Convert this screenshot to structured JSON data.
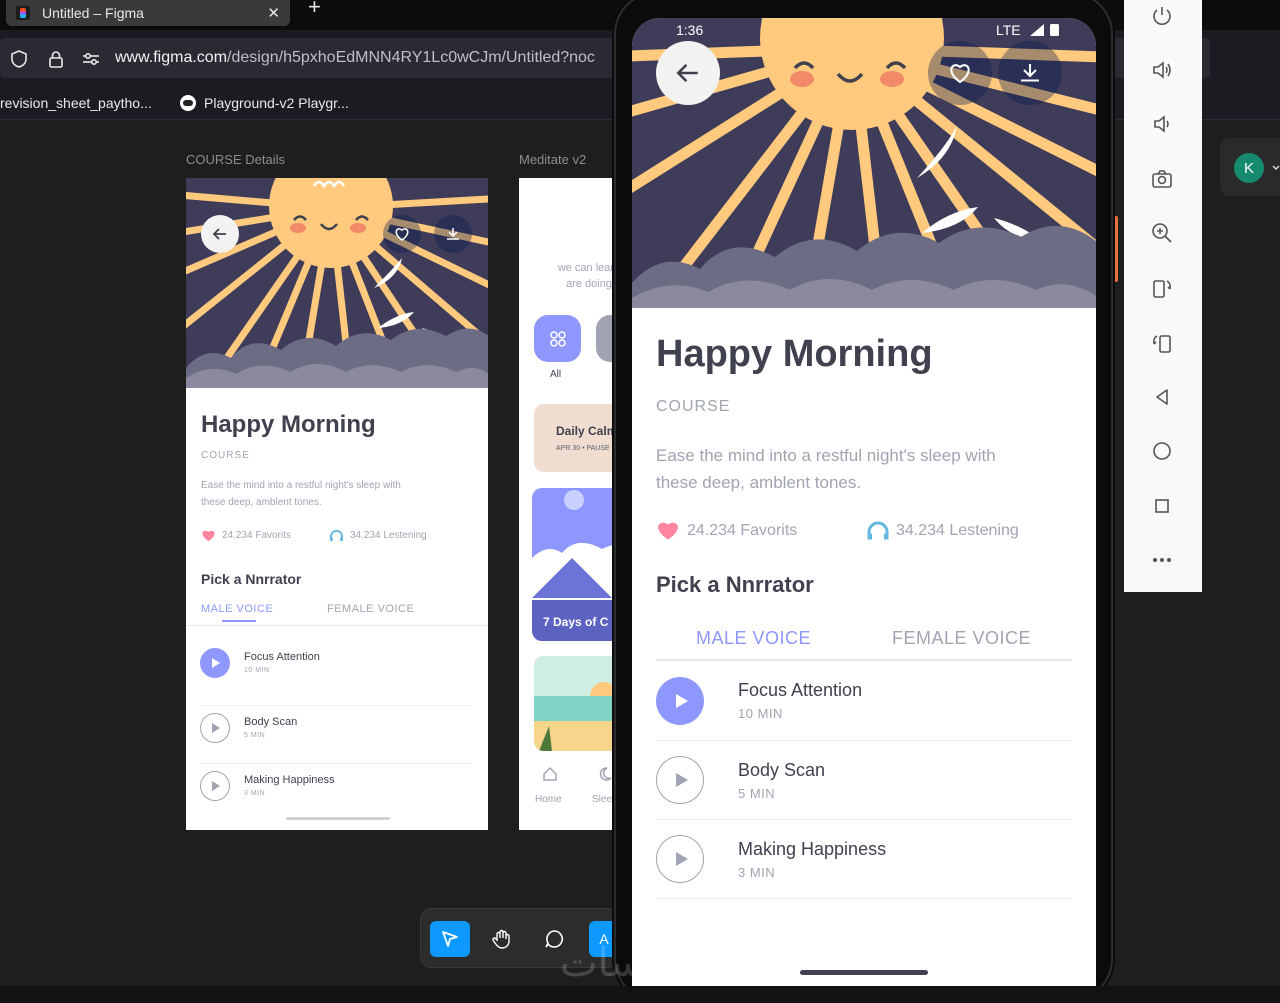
{
  "browser": {
    "tab_title": "Untitled – Figma",
    "close_glyph": "✕",
    "new_tab_glyph": "+",
    "url_host": "www.figma.com",
    "url_path": "/design/h5pxhoEdMNN4RY1Lc0wCJm/Untitled?noc",
    "bookmarks": [
      "revision_sheet_paytho...",
      "Playground-v2  Playgr..."
    ]
  },
  "canvas": {
    "frame_labels": [
      "COURSE Details",
      "Meditate v2"
    ]
  },
  "course": {
    "title": "Happy Morning",
    "subtitle": "COURSE",
    "description_line1": "Ease the mind into a restful night's sleep  with",
    "description_line2": "these deep, amblent tones.",
    "favorites": "24.234 Favorits",
    "listening": "34.234 Lestening",
    "narrator_heading": "Pick a Nnrrator",
    "tabs": [
      "MALE VOICE",
      "FEMALE VOICE"
    ],
    "tracks": [
      {
        "name": "Focus Attention",
        "length": "10 MIN"
      },
      {
        "name": "Body Scan",
        "length": "5 MIN"
      },
      {
        "name": "Making Happiness",
        "length": "3 MIN"
      }
    ]
  },
  "meditate": {
    "text_line1": "we can learn",
    "text_line2": "are doing",
    "category_all": "All",
    "card_daily": "Daily Calm",
    "card_daily_meta": "APR 30 • PAUSE",
    "card_days": "7 Days of C",
    "nav": [
      "Home",
      "Sleep"
    ]
  },
  "phone": {
    "time": "1:36",
    "network": "LTE"
  },
  "toolbar": {
    "partial_label": "A"
  },
  "user": {
    "initial": "K"
  },
  "watermark": "خمسات",
  "colors": {
    "accent": "#8e97fd",
    "heading": "#3f414e",
    "muted": "#a1a4b2",
    "heart": "#ff84a0",
    "headphones": "#65b7e3",
    "sun": "#ffc97e",
    "hero_bg": "#3e3c59",
    "figma_blue": "#0d99ff"
  },
  "icons": [
    "shield-icon",
    "lock-icon",
    "sliders-icon",
    "back-arrow-icon",
    "heart-icon",
    "download-icon",
    "headphones-icon",
    "play-icon",
    "cursor-icon",
    "hand-icon",
    "comment-icon",
    "power-icon",
    "volume-up-icon",
    "volume-down-icon",
    "camera-icon",
    "zoom-in-icon",
    "rotate-left-icon",
    "rotate-right-icon",
    "back-triangle-icon",
    "home-circle-icon",
    "square-icon",
    "more-icon"
  ]
}
